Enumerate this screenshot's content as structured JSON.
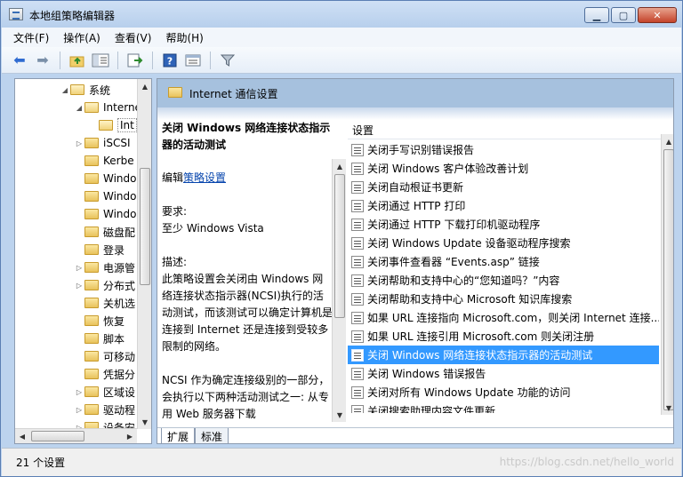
{
  "window": {
    "title": "本地组策略编辑器"
  },
  "menu": [
    "文件(F)",
    "操作(A)",
    "查看(V)",
    "帮助(H)"
  ],
  "toolbar": {
    "icons": [
      "back-icon",
      "forward-icon",
      "up-folder-icon",
      "show-hide-tree-icon",
      "export-list-icon",
      "help-icon",
      "properties-icon",
      "filter-icon"
    ]
  },
  "tree": {
    "items": [
      {
        "label": "系统",
        "expander": "◢",
        "open": true
      },
      {
        "label": "Interne",
        "expander": "◢",
        "open": true
      },
      {
        "label": "Int",
        "expander": "",
        "open": true,
        "selected": true
      },
      {
        "label": "iSCSI",
        "expander": "▷"
      },
      {
        "label": "Kerbe",
        "expander": ""
      },
      {
        "label": "Windo",
        "expander": ""
      },
      {
        "label": "Windo",
        "expander": ""
      },
      {
        "label": "Windo",
        "expander": ""
      },
      {
        "label": "磁盘配",
        "expander": ""
      },
      {
        "label": "登录",
        "expander": ""
      },
      {
        "label": "电源管",
        "expander": "▷"
      },
      {
        "label": "分布式",
        "expander": "▷"
      },
      {
        "label": "关机选",
        "expander": ""
      },
      {
        "label": "恢复",
        "expander": ""
      },
      {
        "label": "脚本",
        "expander": ""
      },
      {
        "label": "可移动",
        "expander": ""
      },
      {
        "label": "凭据分",
        "expander": ""
      },
      {
        "label": "区域设",
        "expander": "▷"
      },
      {
        "label": "驱动程",
        "expander": "▷"
      },
      {
        "label": "设备安",
        "expander": "▷"
      }
    ]
  },
  "right": {
    "header_title": "Internet 通信设置",
    "description": {
      "title": "关闭 Windows 网络连接状态指示器的活动测试",
      "edit_prefix": "编辑",
      "edit_link": "策略设置",
      "requirements_label": "要求:",
      "requirements_value": "至少 Windows Vista",
      "desc_label": "描述:",
      "desc_para1": "此策略设置会关闭由 Windows 网络连接状态指示器(NCSI)执行的活动测试，而该测试可以确定计算机是连接到 Internet 还是连接到受较多限制的网络。",
      "desc_para2": "NCSI 作为确定连接级别的一部分，会执行以下两种活动测试之一: 从专用 Web 服务器下载"
    },
    "list_header": "设置",
    "settings": [
      "关闭手写识别错误报告",
      "关闭 Windows 客户体验改善计划",
      "关闭自动根证书更新",
      "关闭通过 HTTP 打印",
      "关闭通过 HTTP 下载打印机驱动程序",
      "关闭 Windows Update 设备驱动程序搜索",
      "关闭事件查看器 “Events.asp” 链接",
      "关闭帮助和支持中心的“您知道吗？”内容",
      "关闭帮助和支持中心 Microsoft 知识库搜索",
      "如果 URL 连接指向 Microsoft.com，则关闭 Internet 连接...",
      "如果 URL 连接引用 Microsoft.com 则关闭注册",
      "关闭 Windows 网络连接状态指示器的活动测试",
      "关闭 Windows 错误报告",
      "关闭对所有 Windows Update 功能的访问",
      "关闭搜索助理内容文件更新"
    ],
    "selected_index": 11,
    "tabs": [
      "扩展",
      "标准"
    ]
  },
  "status": {
    "text": "21 个设置",
    "watermark": "https://blog.csdn.net/hello_world"
  }
}
